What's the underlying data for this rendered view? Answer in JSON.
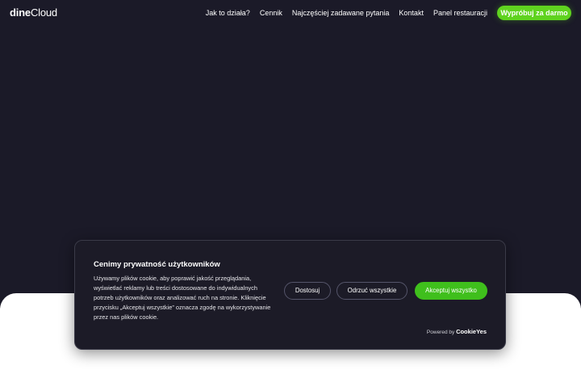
{
  "brand": {
    "logo_bold": "dine",
    "logo_light": "Cloud"
  },
  "nav": {
    "links": [
      {
        "label": "Jak to działa?"
      },
      {
        "label": "Cennik"
      },
      {
        "label": "Najczęściej zadawane pytania"
      },
      {
        "label": "Kontakt"
      },
      {
        "label": "Panel restauracji"
      }
    ],
    "cta_label": "Wypróbuj za darmo"
  },
  "cookie_banner": {
    "title": "Cenimy prywatność użytkowników",
    "body": "Używamy plików cookie, aby poprawić jakość przeglądania, wyświetlać reklamy lub treści dostosowane do indywidualnych potrzeb użytkowników oraz analizować ruch na stronie. Kliknięcie przycisku „Akceptuj wszystkie” oznacza zgodę na wykorzystywanie przez nas plików cookie.",
    "customize_label": "Dostosuj",
    "reject_label": "Odrzuć wszystkie",
    "accept_label": "Akceptuj wszystko",
    "powered_by": "Powered by",
    "powered_brand": "CookieYes"
  },
  "colors": {
    "background": "#1b1a28",
    "accent_green": "#5fd31f",
    "accept_green": "#3fbf1c",
    "banner_bg": "#1c1b27"
  }
}
